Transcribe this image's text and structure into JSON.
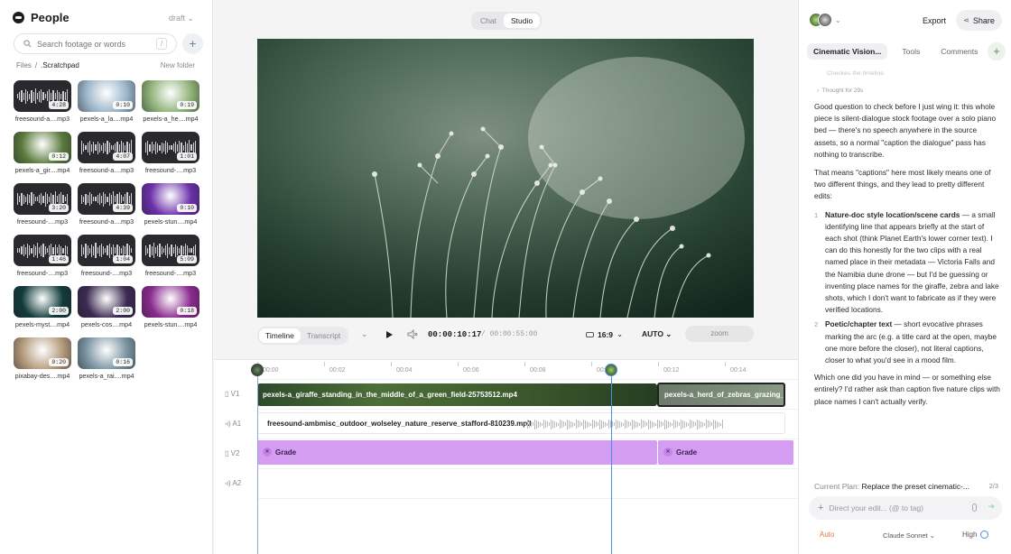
{
  "sidebar": {
    "title": "People",
    "status": "draft",
    "search_placeholder": "Search footage or words",
    "search_shortcut": "/",
    "breadcrumb_root": "Files",
    "breadcrumb_sep": "/",
    "breadcrumb_current": ".Scratchpad",
    "new_folder": "New folder",
    "assets": [
      {
        "name": "freesound-a....mp3",
        "duration": "4:28",
        "kind": "audio"
      },
      {
        "name": "pexels-a_la....mp4",
        "duration": "0:10",
        "kind": "video",
        "color": "#9ab4c8"
      },
      {
        "name": "pexels-a_he....mp4",
        "duration": "0:19",
        "kind": "video",
        "color": "#8fb279"
      },
      {
        "name": "pexels-a_gir....mp4",
        "duration": "0:12",
        "kind": "video",
        "color": "#5a7a3c"
      },
      {
        "name": "freesound-a....mp3",
        "duration": "4:07",
        "kind": "audio"
      },
      {
        "name": "freesound-....mp3",
        "duration": "1:01",
        "kind": "audio"
      },
      {
        "name": "freesound-....mp3",
        "duration": "3:20",
        "kind": "audio"
      },
      {
        "name": "freesound-a....mp3",
        "duration": "4:39",
        "kind": "audio"
      },
      {
        "name": "pexels-stun....mp4",
        "duration": "0:10",
        "kind": "video",
        "color": "#6b2fa8"
      },
      {
        "name": "freesound-....mp3",
        "duration": "1:46",
        "kind": "audio"
      },
      {
        "name": "freesound-....mp3",
        "duration": "1:04",
        "kind": "audio"
      },
      {
        "name": "freesound-....mp3",
        "duration": "5:09",
        "kind": "audio"
      },
      {
        "name": "pexels-myst....mp4",
        "duration": "2:00",
        "kind": "video",
        "color": "#123b3c"
      },
      {
        "name": "pexels-cos....mp4",
        "duration": "2:00",
        "kind": "video",
        "color": "#3b2a52"
      },
      {
        "name": "pexels-stun....mp4",
        "duration": "0:18",
        "kind": "video",
        "color": "#8a2a8e"
      },
      {
        "name": "pixabay-des....mp4",
        "duration": "0:20",
        "kind": "video",
        "color": "#b49a7c"
      },
      {
        "name": "pexels-a_rai....mp4",
        "duration": "0:16",
        "kind": "video",
        "color": "#7a94a2"
      }
    ]
  },
  "center": {
    "mode_tabs": [
      "Chat",
      "Studio"
    ],
    "view_tabs": [
      "Timeline",
      "Transcript"
    ],
    "current_time": "00:00:10:17",
    "total_time": "/ 00:00:55:00",
    "aspect": "16:9",
    "quality": "AUTO",
    "zoom_label": "zoom",
    "ticks": [
      "00:00",
      "00:02",
      "00:04",
      "00:06",
      "00:08",
      "00:10",
      "00:12",
      "00:14"
    ],
    "lanes": [
      "V1",
      "A1",
      "V2",
      "A2"
    ],
    "clip_v1_a": "pexels-a_giraffe_standing_in_the_middle_of_a_green_field-25753512.mp4",
    "clip_v1_b": "pexels-a_herd_of_zebras_grazing_in_",
    "clip_a1": "freesound-ambmisc_outdoor_wolseley_nature_reserve_stafford-810239.mp3",
    "grade_label": "Grade"
  },
  "right": {
    "export": "Export",
    "share": "Share",
    "tabs": [
      "Cinematic Vision...",
      "Tools",
      "Comments"
    ],
    "faded": "Checkes the timeline",
    "thought": "Thought for 29s",
    "p1": "Good question to check before I just wing it: this whole piece is silent-dialogue stock footage over a solo piano bed — there's no speech anywhere in the source assets, so a normal \"caption the dialogue\" pass has nothing to transcribe.",
    "p2": "That means \"captions\" here most likely means one of two different things, and they lead to pretty different edits:",
    "item1_title": "Nature-doc style location/scene cards",
    "item1_body": " — a small identifying line that appears briefly at the start of each shot (think Planet Earth's lower corner text). I can do this honestly for the two clips with a real named place in their metadata — Victoria Falls and the Namibia dune drone — but I'd be guessing or inventing place names for the giraffe, zebra and lake shots, which I don't want to fabricate as if they were verified locations.",
    "item2_title": "Poetic/chapter text",
    "item2_body": " — short evocative phrases marking the arc (e.g. a title card at the open, maybe one more before the closer), not literal captions, closer to what you'd see in a mood film.",
    "p3": "Which one did you have in mind — or something else entirely? I'd rather ask than caption five nature clips with place names I can't actually verify.",
    "plan_label": "Current Plan:",
    "plan_text": "Replace the preset cinematic-...",
    "plan_count": "2/3",
    "input_placeholder": "Direct your edit... (@ to tag)",
    "mode": "Auto",
    "model": "Claude Sonnet",
    "effort": "High"
  }
}
